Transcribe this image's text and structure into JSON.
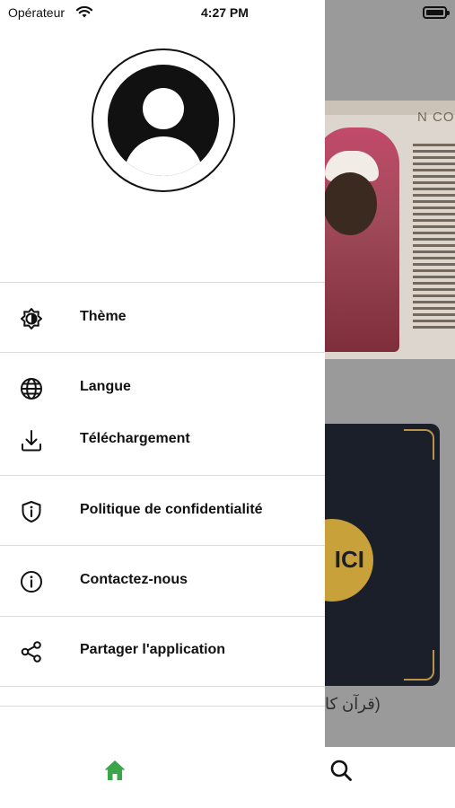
{
  "status_bar": {
    "carrier": "Opérateur",
    "time": "4:27 PM"
  },
  "drawer": {
    "avatar_icon": "user-circle-icon",
    "items": [
      {
        "label": "Thème",
        "icon": "theme-brightness-icon"
      },
      {
        "label": "Langue",
        "icon": "globe-icon"
      },
      {
        "label": "Téléchargement",
        "icon": "download-icon"
      },
      {
        "label": "Politique de confidentialité",
        "icon": "shield-info-icon"
      },
      {
        "label": "Contactez-nous",
        "icon": "info-circle-icon"
      },
      {
        "label": "Partager l'application",
        "icon": "share-icon"
      }
    ]
  },
  "background": {
    "card1_header": "N CO",
    "card2_text": "ICI",
    "arabic_caption": "(قرآن كا"
  },
  "tab_bar": {
    "tabs": [
      {
        "name": "home",
        "icon": "home-icon",
        "active": true,
        "color": "#3aa54a"
      },
      {
        "name": "search",
        "icon": "search-icon",
        "active": false,
        "color": "#111111"
      }
    ]
  },
  "colors": {
    "accent": "#3aa54a",
    "scrim": "#9a9a9a",
    "drawer_bg": "#ffffff",
    "divider": "#dcdcdc"
  }
}
